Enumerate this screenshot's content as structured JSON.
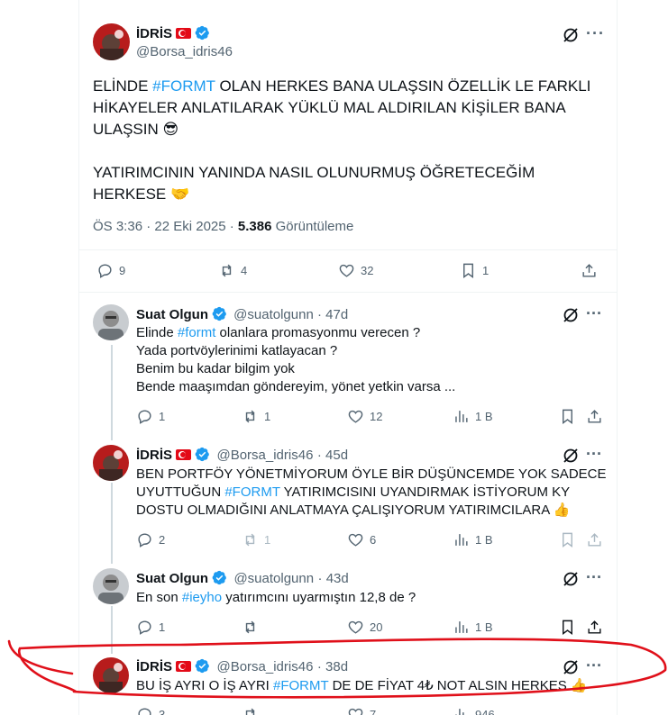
{
  "main_tweet": {
    "name": "İDRİS",
    "handle": "@Borsa_idris46",
    "text_pre": "ELİNDE ",
    "hashtag": "#FORMT",
    "text_post": " OLAN HERKES BANA ULAŞSIN ÖZELLİK LE FARKLI HİKAYELER ANLATILARAK YÜKLÜ MAL ALDIRILAN KİŞİLER BANA ULAŞSIN 😎",
    "text2": "YATIRIMCININ YANINDA NASIL OLUNURMUŞ ÖĞRETECEĞİM HERKESE 🤝",
    "time": "ÖS 3:36 · 22 Eki 2025 · ",
    "views_count": "5.386",
    "views_label": " Görüntüleme",
    "replies": "9",
    "reposts": "4",
    "likes": "32",
    "bookmarks": "1"
  },
  "replies": [
    {
      "name": "Suat Olgun",
      "handle": "@suatolgunn",
      "age": "· 47d",
      "line1_pre": "Elinde ",
      "line1_tag": "#formt",
      "line1_post": " olanlara promasyonmu verecen ?",
      "line2": "Yada portvöylerinimi katlayacan ?",
      "line3": "Benim bu kadar bilgim yok",
      "line4": "Bende maaşımdan göndereyim, yönet yetkin varsa ...",
      "replies": "1",
      "reposts": "1",
      "likes": "12",
      "views": "1 B"
    },
    {
      "name": "İDRİS",
      "handle": "@Borsa_idris46",
      "age": "· 45d",
      "line1": "BEN PORTFÖY YÖNETMİYORUM ÖYLE BİR DÜŞÜNCEMDE YOK SADECE",
      "line2_pre": "UYUTTUĞUN ",
      "line2_tag": "#FORMT",
      "line2_post": " YATIRIMCISINI UYANDIRMAK İSTİYORUM KY",
      "line3": "DOSTU OLMADIĞINI ANLATMAYA ÇALIŞIYORUM YATIRIMCILARA 👍",
      "replies": "2",
      "reposts": "1",
      "likes": "6",
      "views": "1 B"
    },
    {
      "name": "Suat Olgun",
      "handle": "@suatolgunn",
      "age": "· 43d",
      "line1_pre": "En son ",
      "line1_tag": "#ieyho",
      "line1_post": " yatırımcını uyarmıştın 12,8 de ?",
      "replies": "1",
      "reposts": "",
      "likes": "20",
      "views": "1 B"
    },
    {
      "name": "İDRİS",
      "handle": "@Borsa_idris46",
      "age": "· 38d",
      "line1_pre": "BU İŞ AYRI O İŞ AYRI ",
      "line1_tag": "#FORMT",
      "line1_post": " DE DE FİYAT 4₺ NOT ALSIN HERKES 👍",
      "replies": "3",
      "reposts": "",
      "likes": "7",
      "views": "946"
    }
  ],
  "colors": {
    "accent": "#1d9bf0",
    "annotation": "#e0101a",
    "muted": "#536471"
  }
}
